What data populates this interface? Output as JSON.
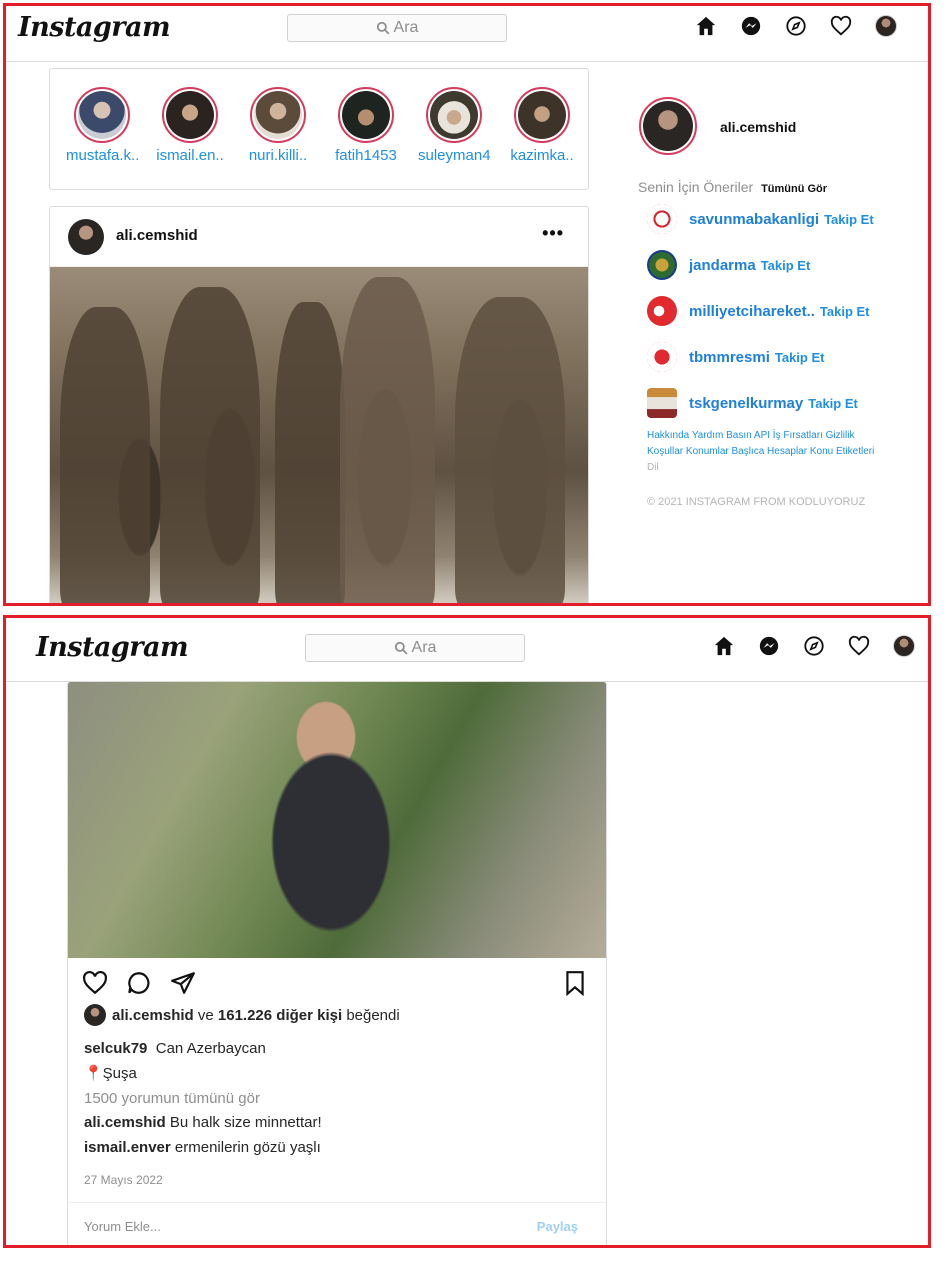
{
  "colors": {
    "frame": "#e11d2a",
    "link": "#1f8fe3",
    "share": "#9fd0f6"
  },
  "navbar": {
    "logo": "Instagram",
    "search_placeholder": "Ara",
    "icons": [
      "home-icon",
      "messenger-icon",
      "explore-icon",
      "heart-icon",
      "profile-avatar"
    ]
  },
  "stories": [
    {
      "name": "mustafa.k.."
    },
    {
      "name": "ismail.en.."
    },
    {
      "name": "nuri.killi.."
    },
    {
      "name": "fatih1453"
    },
    {
      "name": "suleyman4.."
    },
    {
      "name": "kazimka.."
    }
  ],
  "post1": {
    "username": "ali.cemshid",
    "more": "•••"
  },
  "sidebar": {
    "username": "ali.cemshid",
    "suggestions_title": "Senin İçin Öneriler",
    "see_all": "Tümünü Gör",
    "follow_label": "Takip Et",
    "suggestions": [
      {
        "name": "savunmabakanligi"
      },
      {
        "name": "jandarma"
      },
      {
        "name": "milliyetcihareket.."
      },
      {
        "name": "tbmmresmi"
      },
      {
        "name": "tskgenelkurmay"
      }
    ],
    "footer_links": "Hakkında Yardım Basın API İş Fırsatları Gizlilik Koşullar Konumlar Başlıca Hesaplar Konu Etiketleri",
    "footer_lang": "Dil",
    "copyright": "© 2021 INSTAGRAM FROM KODLUYORUZ"
  },
  "post2": {
    "liked_by_user": "ali.cemshid",
    "liked_and": "ve",
    "liked_others": "161.226 diğer kişi",
    "liked_suffix": "beğendi",
    "caption_user": "selcuk79",
    "caption_text": "Can Azerbaycan",
    "location": "📍Şuşa",
    "view_comments": "1500 yorumun tümünü gör",
    "comments": [
      {
        "user": "ali.cemshid",
        "text": "Bu halk size minnettar!"
      },
      {
        "user": "ismail.enver",
        "text": "ermenilerin gözü yaşlı"
      }
    ],
    "date": "27 Mayıs 2022",
    "comment_placeholder": "Yorum Ekle...",
    "share_label": "Paylaş"
  }
}
